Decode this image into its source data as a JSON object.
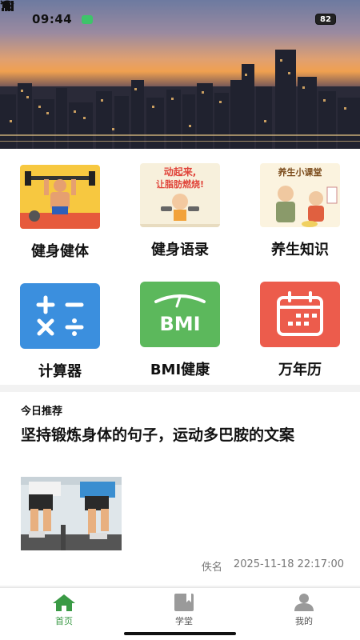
{
  "status_bar": {
    "time": "09:44",
    "battery": "82",
    "icons": [
      "chat-notification-icon",
      "mute-icon",
      "wifi-icon",
      "cellular-4g-icon",
      "cellular-5g-icon",
      "battery-icon"
    ]
  },
  "hero": {
    "image": "city-skyline-at-sunset"
  },
  "grid": {
    "items": [
      {
        "label": "健身健体",
        "icon": "fitness-illustration",
        "image_text": ""
      },
      {
        "label": "健身语录",
        "icon": "quote-illustration",
        "image_text": "动起来，让脂肪燃烧!"
      },
      {
        "label": "养生知识",
        "icon": "health-class-illustration",
        "image_text": "养生小课堂"
      },
      {
        "label": "计算器",
        "icon": "calculator-icon",
        "color": "#3b8fde"
      },
      {
        "label": "BMI健康",
        "icon": "bmi-scale-icon",
        "color": "#5cb85c",
        "icon_text": "BMI"
      },
      {
        "label": "万年历",
        "icon": "calendar-icon",
        "color": "#ec5c4c"
      }
    ]
  },
  "recommend": {
    "heading": "今日推荐",
    "title": "坚持锻炼身体的句子，运动多巴胺的文案",
    "image": "treadmill-running-photo",
    "author": "佚名",
    "datetime": "2025-11-18 22:17:00"
  },
  "tabs": [
    {
      "label": "首页",
      "icon": "home-icon",
      "active": true
    },
    {
      "label": "学堂",
      "icon": "book-icon",
      "active": false
    },
    {
      "label": "我的",
      "icon": "profile-icon",
      "active": false
    }
  ],
  "colors": {
    "accent": "#3a9a45",
    "tab_inactive": "#9a9a9a"
  }
}
